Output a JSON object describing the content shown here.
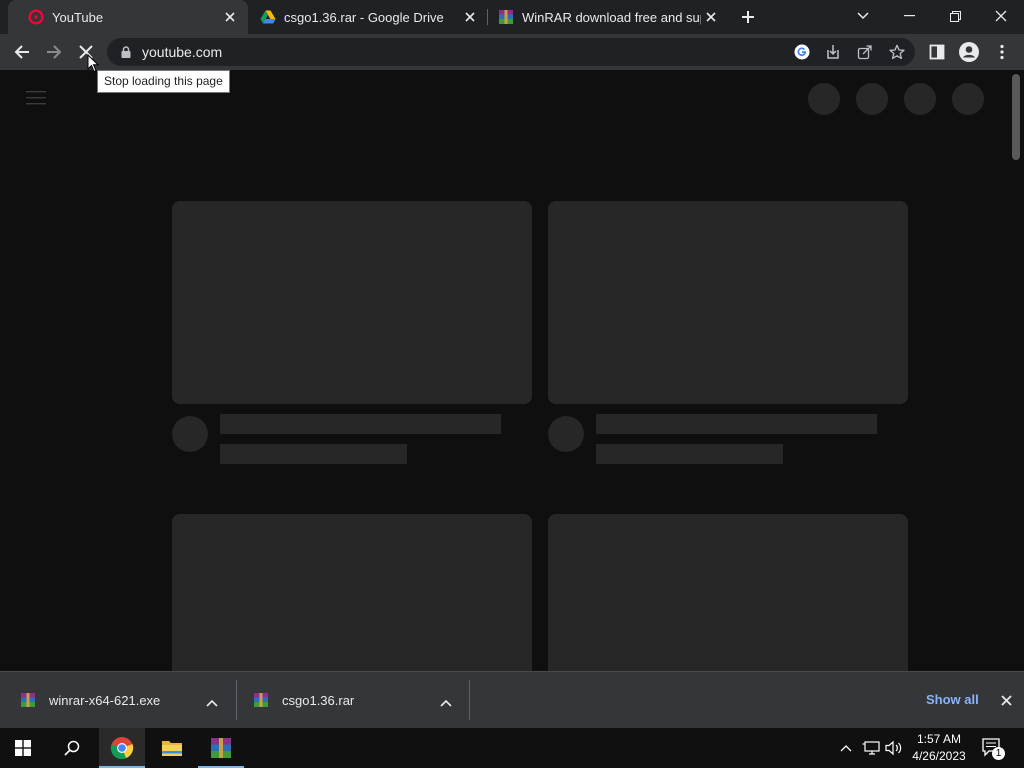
{
  "browser": {
    "tabs": [
      {
        "title": "YouTube",
        "favicon": "youtube-icon",
        "active": true
      },
      {
        "title": "csgo1.36.rar - Google Drive",
        "favicon": "google-drive-icon",
        "active": false
      },
      {
        "title": "WinRAR download free and supp",
        "favicon": "winrar-icon",
        "active": false
      }
    ],
    "url": "youtube.com",
    "tooltip": "Stop loading this page",
    "loading": true
  },
  "downloads": {
    "items": [
      {
        "filename": "winrar-x64-621.exe",
        "icon": "winrar-icon"
      },
      {
        "filename": "csgo1.36.rar",
        "icon": "winrar-icon"
      }
    ],
    "show_all_label": "Show all"
  },
  "taskbar": {
    "time": "1:57 AM",
    "date": "4/26/2023",
    "notification_count": "1"
  },
  "colors": {
    "page_bg": "#0f0f0f",
    "skeleton": "#272727",
    "toolbar": "#35363a",
    "tabstrip": "#202124",
    "link_blue": "#8ab4f8"
  }
}
